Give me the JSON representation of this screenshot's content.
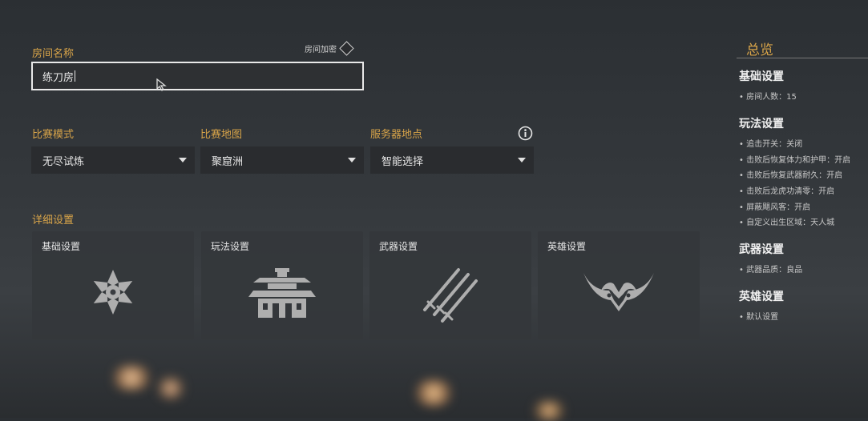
{
  "room": {
    "name_label": "房间名称",
    "name_value": "练刀房",
    "encrypt_label": "房间加密"
  },
  "settings": {
    "mode": {
      "label": "比赛模式",
      "value": "无尽试炼"
    },
    "map": {
      "label": "比赛地图",
      "value": "聚窟洲"
    },
    "server": {
      "label": "服务器地点",
      "value": "智能选择"
    },
    "info_icon": "info-icon"
  },
  "details": {
    "label": "详细设置",
    "cards": [
      {
        "title": "基础设置",
        "icon": "flower-emblem-icon"
      },
      {
        "title": "玩法设置",
        "icon": "pagoda-icon"
      },
      {
        "title": "武器设置",
        "icon": "swords-icon"
      },
      {
        "title": "英雄设置",
        "icon": "horned-mask-icon"
      }
    ]
  },
  "overview": {
    "title": "总览",
    "sections": [
      {
        "heading": "基础设置",
        "items": [
          "• 房间人数：15"
        ]
      },
      {
        "heading": "玩法设置",
        "items": [
          "• 追击开关：关闭",
          "• 击败后恢复体力和护甲：开启",
          "• 击败后恢复武器耐久：开启",
          "• 击败后龙虎功清零：开启",
          "• 屏蔽飓风客：开启",
          "• 自定义出生区域：天人城"
        ]
      },
      {
        "heading": "武器设置",
        "items": [
          "• 武器品质：良品"
        ]
      },
      {
        "heading": "英雄设置",
        "items": [
          "• 默认设置"
        ]
      }
    ]
  },
  "colors": {
    "accent": "#d8a449",
    "panel": "#34373b",
    "field_border": "#e9e9e9"
  }
}
